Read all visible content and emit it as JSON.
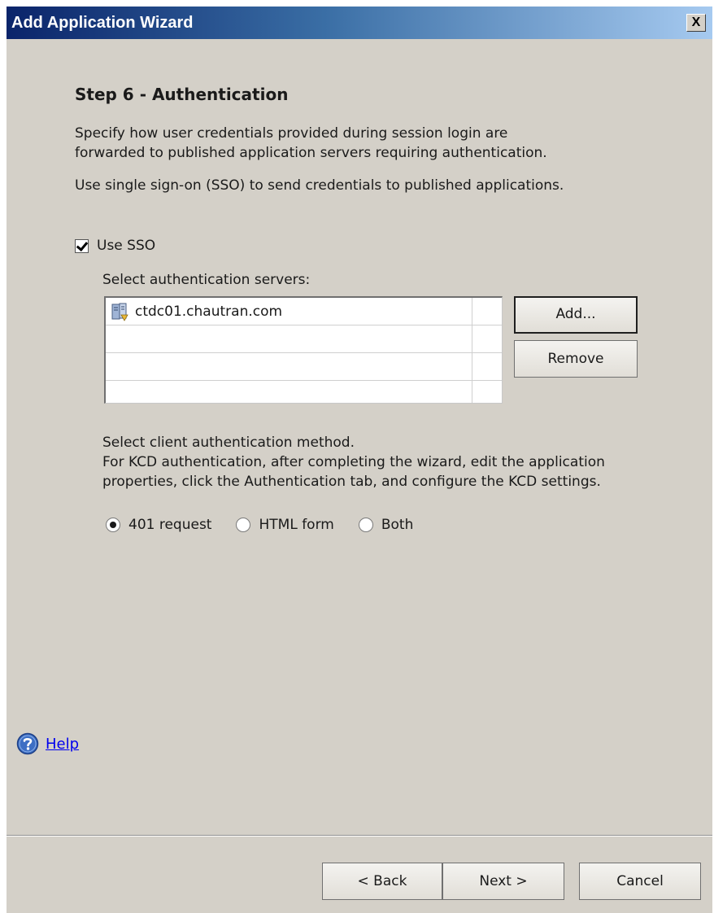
{
  "window": {
    "title": "Add Application Wizard",
    "close_label": "X"
  },
  "step": {
    "title": "Step 6 - Authentication",
    "description_line1": "Specify how user credentials provided during session login are",
    "description_line2": "forwarded to published application servers requiring authentication.",
    "sso_description": "Use single sign-on (SSO) to send credentials to published applications."
  },
  "sso": {
    "checkbox_label": "Use SSO",
    "checked": true,
    "servers_label": "Select authentication servers:",
    "servers": [
      {
        "name": "ctdc01.chautran.com",
        "icon": "server-icon"
      }
    ],
    "add_button": "Add...",
    "remove_button": "Remove"
  },
  "client_auth": {
    "line1": "Select client authentication method.",
    "line2": "For KCD authentication, after completing the wizard, edit the application",
    "line3": "properties, click the Authentication tab, and configure the KCD settings.",
    "options": [
      {
        "label": "401 request",
        "checked": true
      },
      {
        "label": "HTML form",
        "checked": false
      },
      {
        "label": "Both",
        "checked": false
      }
    ]
  },
  "help": {
    "link_label": "Help",
    "icon": "help-icon"
  },
  "footer": {
    "back_button": "< Back",
    "next_button": "Next >",
    "cancel_button": "Cancel"
  },
  "colors": {
    "dialog_background": "#d4d0c8",
    "title_bar_start": "#0a246a",
    "title_bar_end": "#a6caf0",
    "link": "#0000ee"
  }
}
